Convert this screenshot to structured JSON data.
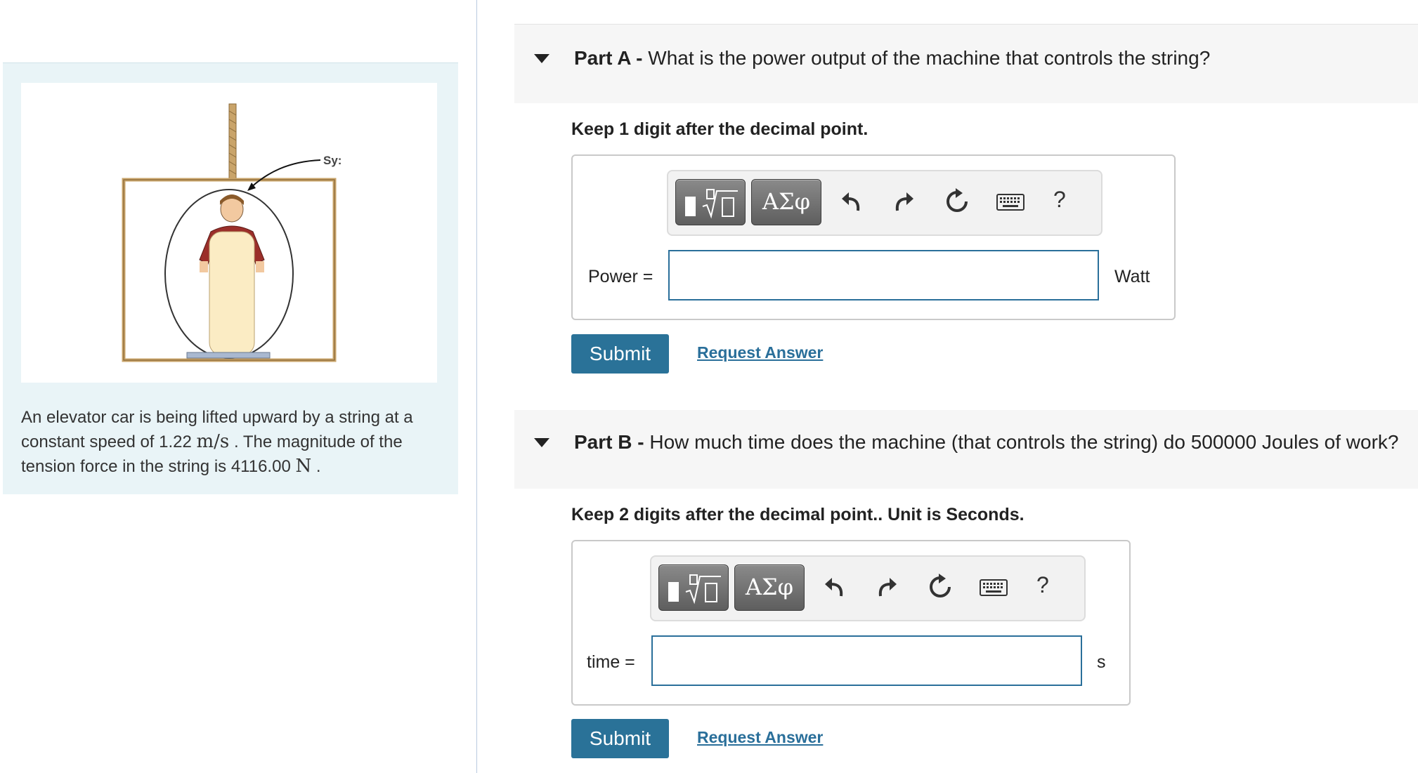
{
  "problem": {
    "figure_label": "Sy:",
    "text_pre": "An elevator car is being lifted upward by a string at a constant speed of 1.22 ",
    "speed_unit": "m/s",
    "text_mid": " . The magnitude of the tension force in the string is 4116.00 ",
    "force_unit": "N",
    "text_post": " ."
  },
  "toolbar": {
    "symbols_label": "ΑΣφ",
    "help_label": "?"
  },
  "part_a": {
    "label": "Part A - ",
    "question": "What is the power output of the machine that controls the string?",
    "instruction": "Keep 1 digit after the decimal point.",
    "field_label": "Power =",
    "input_value": "",
    "unit": "Watt",
    "submit": "Submit",
    "request": "Request Answer"
  },
  "part_b": {
    "label": "Part B - ",
    "question": "How much time does the machine (that controls the string) do 500000 Joules of work?",
    "instruction": "Keep 2 digits after the decimal point.. Unit is Seconds.",
    "field_label": "time =",
    "input_value": "",
    "unit": "s",
    "submit": "Submit",
    "request": "Request Answer"
  }
}
